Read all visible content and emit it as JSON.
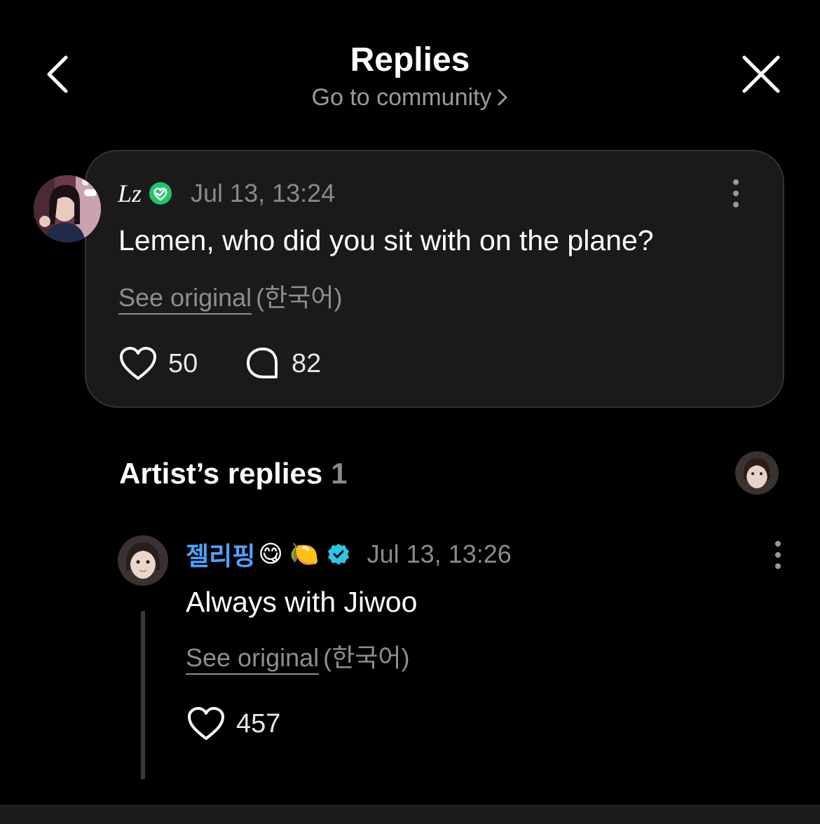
{
  "header": {
    "title": "Replies",
    "community_link": "Go to community",
    "back_icon": "chevron-left-icon",
    "close_icon": "close-icon"
  },
  "comment": {
    "author": "Lz",
    "badge_icon": "membership-check-icon",
    "time": "Jul 13, 13:24",
    "text": "Lemen, who did you sit with on the plane?",
    "see_original": "See original",
    "language": "(한국어)",
    "likes": "50",
    "replies": "82"
  },
  "artist_replies": {
    "heading": "Artist’s replies",
    "count": "1"
  },
  "reply": {
    "author": "젤리핑",
    "author_emojis": "😋 🍋",
    "verified_icon": "verified-badge-icon",
    "time": "Jul 13, 13:26",
    "text": "Always with Jiwoo",
    "see_original": "See original",
    "language": "(한국어)",
    "likes": "457"
  },
  "colors": {
    "background": "#000000",
    "card": "#1a1a1a",
    "artist_name": "#4fa3ff",
    "membership_badge": "#1fc76a",
    "verified_badge": "#2ec4e6",
    "muted_text": "#8a8a8a"
  }
}
